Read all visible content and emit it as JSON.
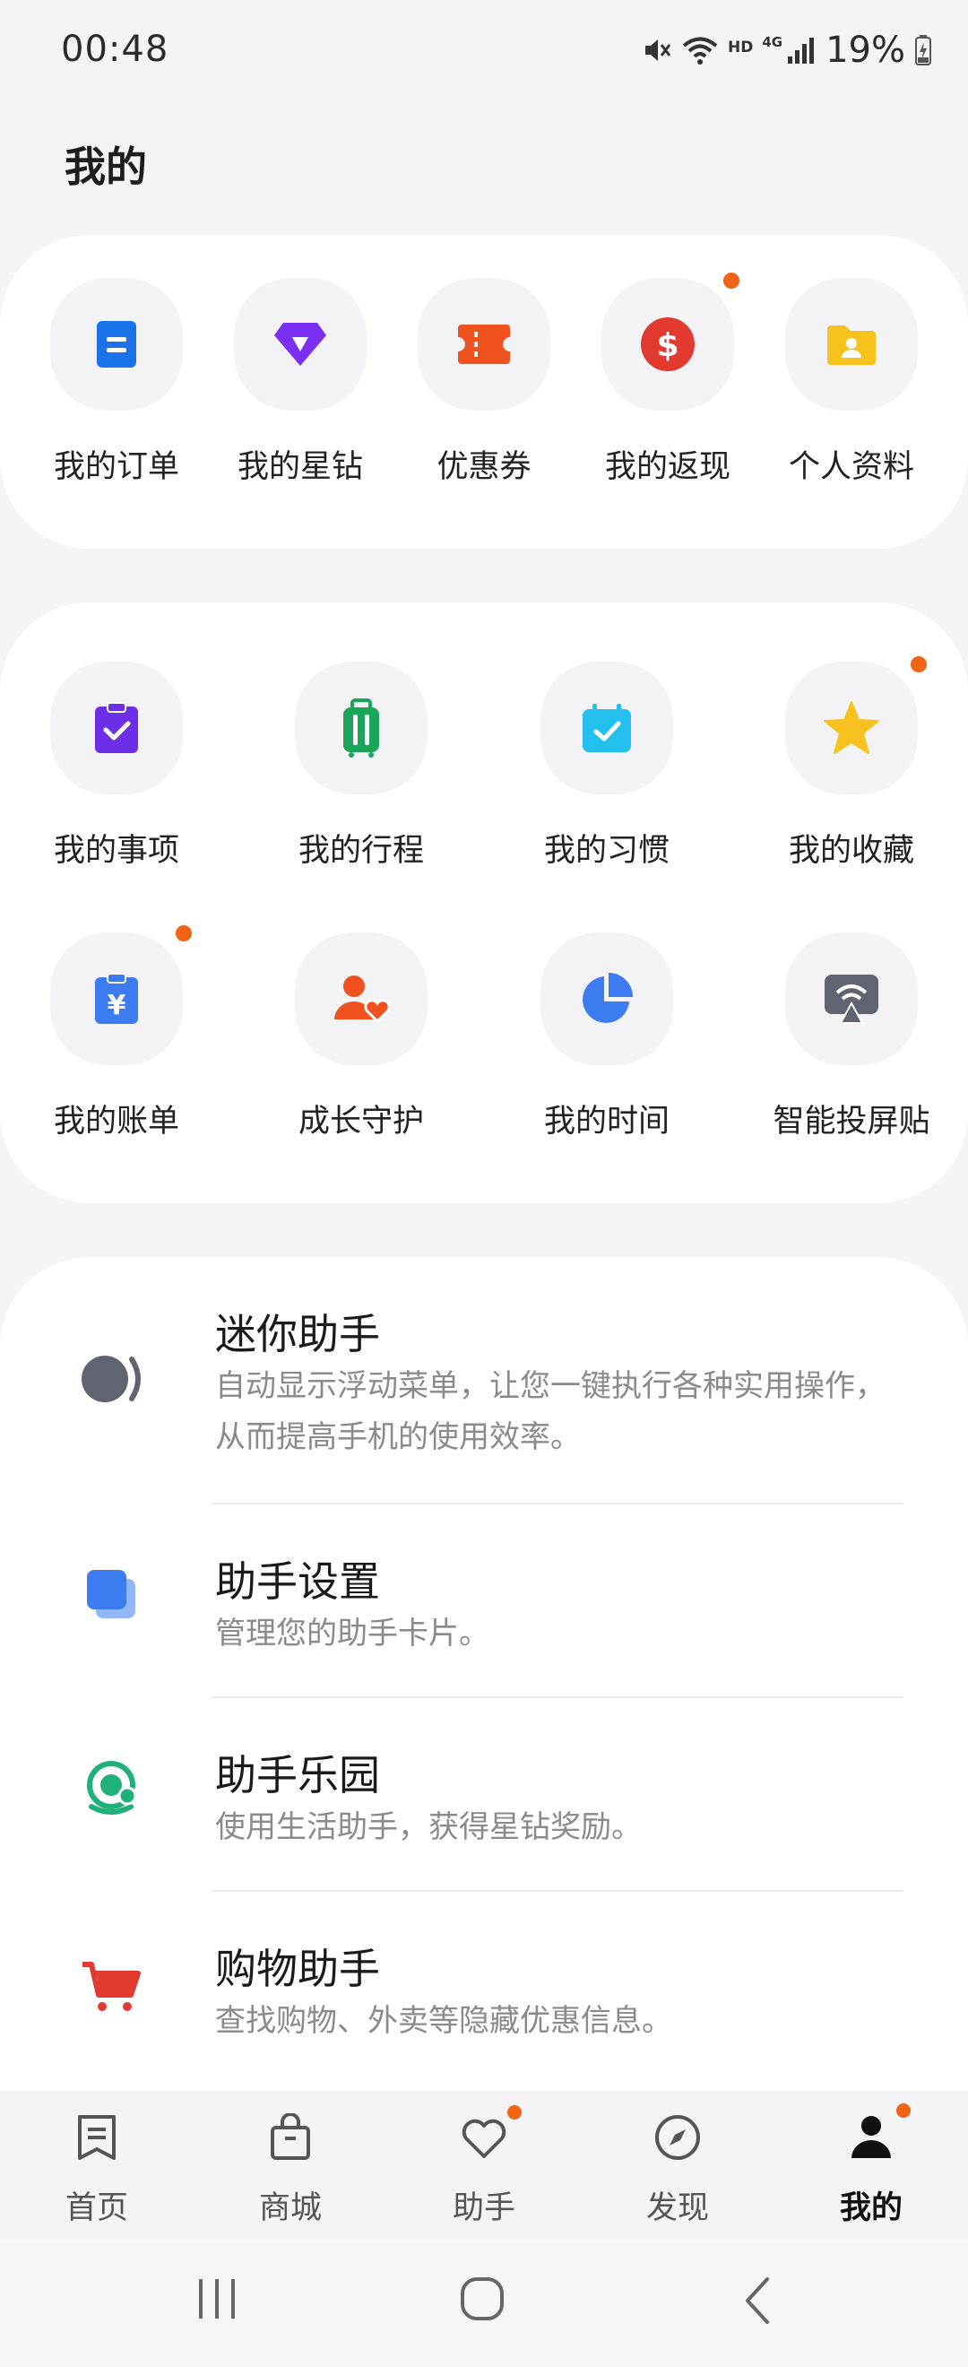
{
  "status_bar": {
    "time": "00:48",
    "hd": "HD",
    "network": "4G",
    "battery": "19%"
  },
  "page": {
    "title": "我的"
  },
  "quick_grid": [
    {
      "label": "我的订单",
      "icon": "order-icon",
      "color": "#1a73e8"
    },
    {
      "label": "我的星钻",
      "icon": "diamond-icon",
      "color": "#7b2ff2"
    },
    {
      "label": "优惠券",
      "icon": "coupon-icon",
      "color": "#f0521f"
    },
    {
      "label": "我的返现",
      "icon": "cashback-icon",
      "color": "#e23a2e"
    },
    {
      "label": "个人资料",
      "icon": "profile-folder-icon",
      "color": "#f8c21c"
    }
  ],
  "tools_grid": [
    {
      "label": "我的事项",
      "icon": "clipboard-check-icon",
      "color": "#6c2ee6"
    },
    {
      "label": "我的行程",
      "icon": "luggage-icon",
      "color": "#1aa55a"
    },
    {
      "label": "我的习惯",
      "icon": "calendar-check-icon",
      "color": "#23c0ee"
    },
    {
      "label": "我的收藏",
      "icon": "star-icon",
      "color": "#f7c21d"
    },
    {
      "label": "我的账单",
      "icon": "bill-icon",
      "color": "#3c7bf0"
    },
    {
      "label": "成长守护",
      "icon": "guardian-icon",
      "color": "#f0521f"
    },
    {
      "label": "我的时间",
      "icon": "pie-chart-icon",
      "color": "#3c7bf0"
    },
    {
      "label": "智能投屏贴",
      "icon": "screen-cast-icon",
      "color": "#5f6470"
    }
  ],
  "assistant_list": [
    {
      "title": "迷你助手",
      "desc": "自动显示浮动菜单，让您一键执行各种实用操作，从而提高手机的使用效率。",
      "icon": "mini-assistant-icon"
    },
    {
      "title": "助手设置",
      "desc": "管理您的助手卡片。",
      "icon": "cards-icon"
    },
    {
      "title": "助手乐园",
      "desc": "使用生活助手，获得星钻奖励。",
      "icon": "park-icon"
    },
    {
      "title": "购物助手",
      "desc": "查找购物、外卖等隐藏优惠信息。",
      "icon": "cart-icon"
    }
  ],
  "bottom_nav": [
    {
      "label": "首页",
      "icon": "home-icon"
    },
    {
      "label": "商城",
      "icon": "shop-bag-icon"
    },
    {
      "label": "助手",
      "icon": "heart-icon"
    },
    {
      "label": "发现",
      "icon": "compass-icon"
    },
    {
      "label": "我的",
      "icon": "user-icon"
    }
  ],
  "system_nav": [
    "recents-icon",
    "home-button-icon",
    "back-icon"
  ]
}
